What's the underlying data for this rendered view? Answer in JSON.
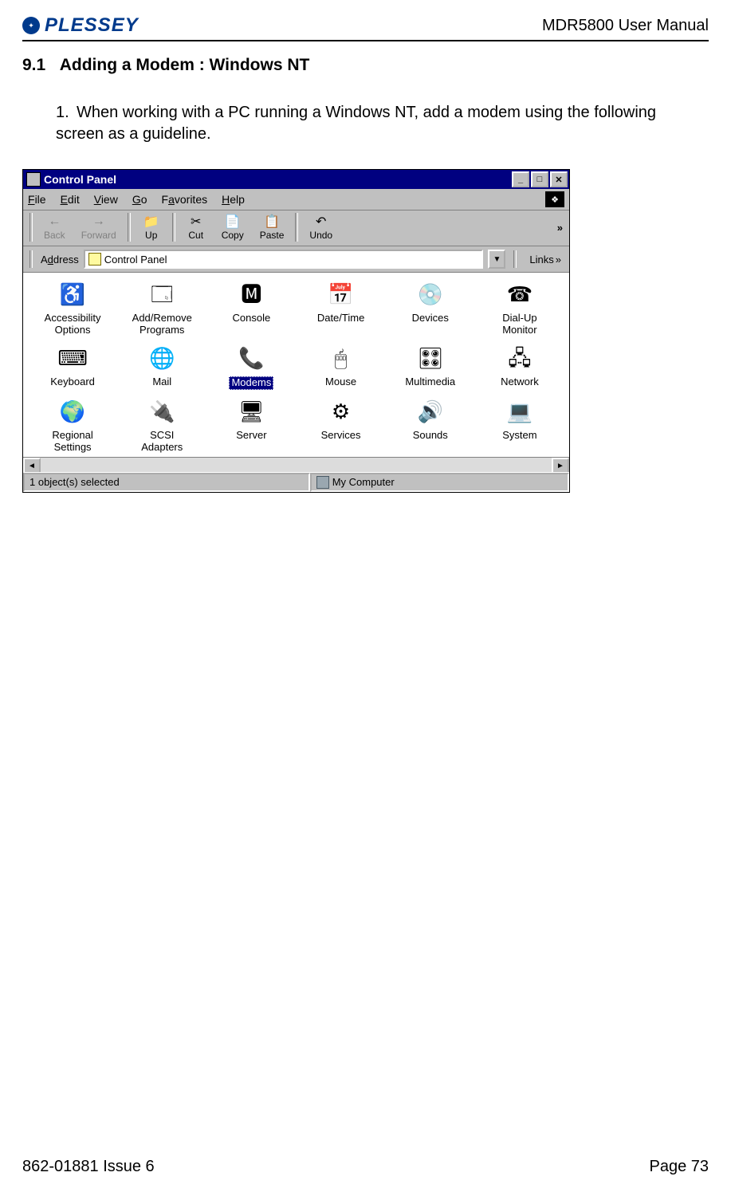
{
  "doc": {
    "logo_text": "PLESSEY",
    "header_right": "MDR5800 User Manual",
    "section_number": "9.1",
    "section_title": "Adding a Modem : Windows NT",
    "list_number": "1.",
    "body": "When working with a PC running a Windows NT, add a modem using the following screen as a guideline.",
    "footer_left": "862-01881 Issue 6",
    "footer_right": "Page 73"
  },
  "window": {
    "title": "Control Panel",
    "btn_min": "_",
    "btn_max": "□",
    "btn_close": "✕"
  },
  "menu": {
    "file": "File",
    "edit": "Edit",
    "view": "View",
    "go": "Go",
    "favorites": "Favorites",
    "help": "Help"
  },
  "toolbar": {
    "back": "Back",
    "forward": "Forward",
    "up": "Up",
    "cut": "Cut",
    "copy": "Copy",
    "paste": "Paste",
    "undo": "Undo",
    "more": "»"
  },
  "addressbar": {
    "label": "Address",
    "value": "Control Panel",
    "links": "Links",
    "links_more": "»"
  },
  "icons": [
    {
      "label": "Accessibility Options",
      "glyph": "♿"
    },
    {
      "label": "Add/Remove Programs",
      "glyph": "🗔"
    },
    {
      "label": "Console",
      "glyph": "🅼"
    },
    {
      "label": "Date/Time",
      "glyph": "📅"
    },
    {
      "label": "Devices",
      "glyph": "💿"
    },
    {
      "label": "Dial-Up Monitor",
      "glyph": "☎"
    },
    {
      "label": "Keyboard",
      "glyph": "⌨"
    },
    {
      "label": "Mail",
      "glyph": "🌐"
    },
    {
      "label": "Modems",
      "glyph": "📞",
      "selected": true
    },
    {
      "label": "Mouse",
      "glyph": "🖱"
    },
    {
      "label": "Multimedia",
      "glyph": "🎛"
    },
    {
      "label": "Network",
      "glyph": "🖧"
    },
    {
      "label": "Regional Settings",
      "glyph": "🌍"
    },
    {
      "label": "SCSI Adapters",
      "glyph": "🔌"
    },
    {
      "label": "Server",
      "glyph": "🖥"
    },
    {
      "label": "Services",
      "glyph": "⚙"
    },
    {
      "label": "Sounds",
      "glyph": "🔊"
    },
    {
      "label": "System",
      "glyph": "💻"
    }
  ],
  "statusbar": {
    "left": "1 object(s) selected",
    "right": "My Computer"
  }
}
